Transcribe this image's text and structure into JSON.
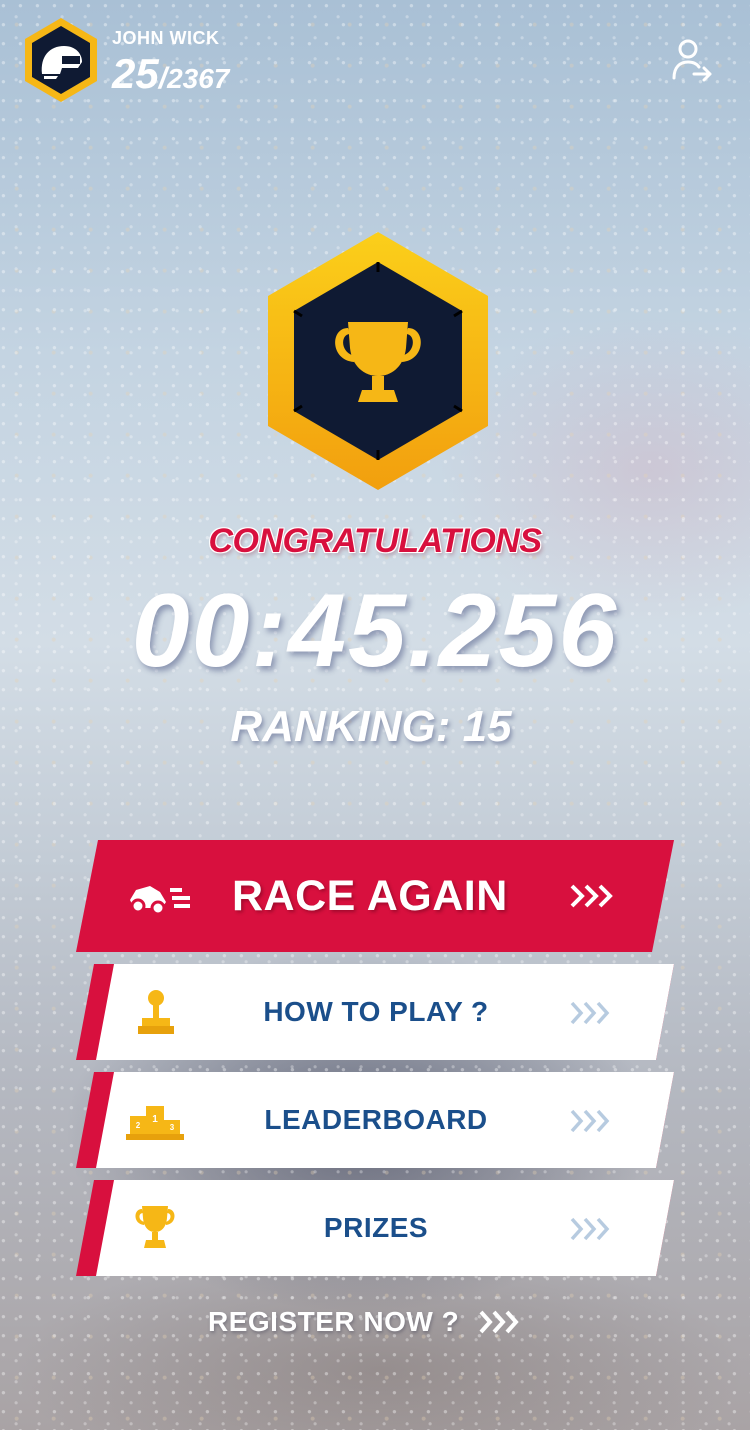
{
  "user": {
    "name": "JOHN WICK",
    "score_current": "25",
    "score_separator": "/",
    "score_total": "2367",
    "avatar_icon": "helmet-icon",
    "logout_icon": "user-logout-icon"
  },
  "result": {
    "badge_icon": "trophy-icon",
    "title": "CONGRATULATIONS",
    "time": "00:45.256",
    "ranking": "RANKING: 15"
  },
  "actions": {
    "race_again": {
      "label": "RACE AGAIN",
      "icon": "race-car-icon"
    },
    "menu": [
      {
        "label": "HOW TO PLAY ?",
        "icon": "joystick-icon"
      },
      {
        "label": "LEADERBOARD",
        "icon": "podium-icon"
      },
      {
        "label": "PRIZES",
        "icon": "trophy-icon"
      }
    ],
    "register": {
      "label": "REGISTER NOW ?"
    }
  },
  "colors": {
    "primary_red": "#d8103e",
    "gold": "#f6b716",
    "navy": "#0f1a33",
    "menu_text": "#1b4f8b",
    "chevron_light": "#b7cbe0"
  }
}
